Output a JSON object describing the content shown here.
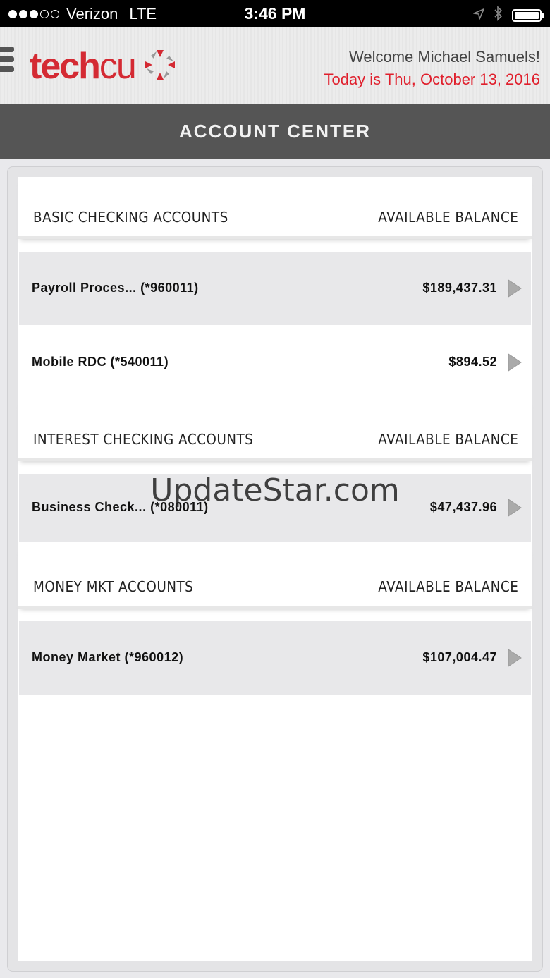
{
  "status_bar": {
    "carrier": "Verizon",
    "network": "LTE",
    "time": "3:46 PM",
    "signal_bars_filled": 3,
    "signal_bars_total": 5,
    "battery_level": 1.0
  },
  "header": {
    "logo_tech": "tech",
    "logo_cu": "cu",
    "welcome": "Welcome Michael Samuels!",
    "date": "Today is Thu, October 13, 2016",
    "brand_color": "#d42a33"
  },
  "title_bar": {
    "title": "ACCOUNT CENTER"
  },
  "sections": [
    {
      "title": "BASIC CHECKING ACCOUNTS",
      "balance_header": "AVAILABLE BALANCE",
      "accounts": [
        {
          "name": "Payroll Proces...  (*960011)",
          "balance": "$189,437.31"
        },
        {
          "name": "Mobile RDC (*540011)",
          "balance": "$894.52"
        }
      ]
    },
    {
      "title": "INTEREST CHECKING ACCOUNTS",
      "balance_header": "AVAILABLE BALANCE",
      "accounts": [
        {
          "name": "Business Check...  (*080011)",
          "balance": "$47,437.96"
        }
      ]
    },
    {
      "title": "MONEY MKT ACCOUNTS",
      "balance_header": "AVAILABLE BALANCE",
      "accounts": [
        {
          "name": "Money Market (*960012)",
          "balance": "$107,004.47"
        }
      ]
    }
  ],
  "watermark": "UpdateStar.com",
  "icons": {
    "menu": "hamburger-icon",
    "location": "location-arrow-icon",
    "bluetooth": "bluetooth-icon",
    "battery": "battery-icon",
    "row_chevron": "chevron-right-icon"
  }
}
